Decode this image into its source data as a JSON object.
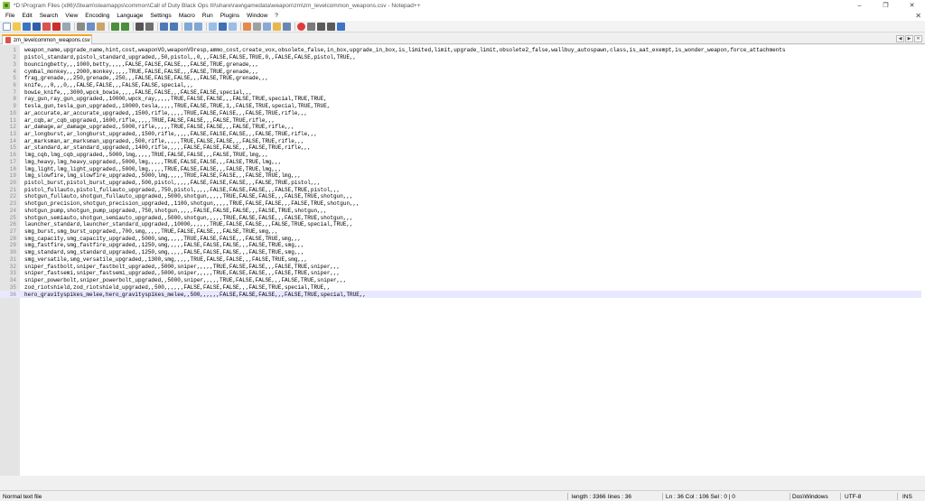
{
  "window": {
    "title": "*D:\\Program Files (x86)\\Steam\\steamapps\\common\\Call of Duty Black Ops III\\share\\raw\\gamedata\\weapon\\zm\\zm_levelcommon_weapons.csv - Notepad++",
    "minimize": "–",
    "maximize": "❐",
    "close": "✕"
  },
  "menu": {
    "items": [
      "File",
      "Edit",
      "Search",
      "View",
      "Encoding",
      "Language",
      "Settings",
      "Macro",
      "Run",
      "Plugins",
      "Window",
      "?"
    ],
    "close": "✕"
  },
  "toolbar": {
    "buttons": [
      "new-file-icon",
      "open-file-icon",
      "save-icon",
      "save-all-icon",
      "close-icon",
      "close-all-icon",
      "print-icon",
      "cut-icon",
      "copy-icon",
      "paste-icon",
      "undo-icon",
      "redo-icon",
      "find-icon",
      "replace-icon",
      "zoom-in-icon",
      "zoom-out-icon",
      "sync-v-icon",
      "sync-h-icon",
      "word-wrap-icon",
      "show-all-chars-icon",
      "indent-guide-icon",
      "udl-icon",
      "doc-map-icon",
      "function-list-icon",
      "folder-workspace-icon",
      "monitor-icon",
      "record-macro-icon",
      "stop-record-icon",
      "play-macro-icon",
      "play-multiple-icon",
      "save-macro-icon"
    ]
  },
  "tab": {
    "label": "zm_levelcommon_weapons.csv",
    "close": "✕"
  },
  "tab_nav": {
    "left": "◀",
    "right": "▶",
    "close": "✕"
  },
  "editor": {
    "current_line": 36,
    "lines": [
      "weapon_name,upgrade_name,hint,cost,weaponVO,weaponVOresp,ammo_cost,create_vox,obsolete_false,in_box,upgrade_in_box,is_limited,limit,upgrade_limit,obsolete2_false,wallbuy_autospawn,class,is_aat_exempt,is_wonder_weapon,force_attachments",
      "pistol_standard,pistol_standard_upgraded,,50,pistol,,0,,,FALSE,FALSE,TRUE,0,,FALSE,FALSE,pistol,TRUE,,",
      "bouncingbetty,,,1000,betty,,,,,FALSE,FALSE,FALSE,,,FALSE,TRUE,grenade,,,",
      "cymbal_monkey,,,2000,monkey,,,,,TRUE,FALSE,FALSE,,,FALSE,TRUE,grenade,,,",
      "frag_grenade,,,250,grenade,,250,,,FALSE,FALSE,FALSE,,,FALSE,TRUE,grenade,,,",
      "knife,,,0,,,0,,,FALSE,FALSE,,,FALSE,FALSE,special,,,",
      "bowie_knife,,,3000,wpck_bowie,,,,,FALSE,FALSE,,,FALSE,FALSE,special,,,",
      "ray_gun,ray_gun_upgraded,,10000,wpck_ray,,,,,TRUE,FALSE,FALSE,,,FALSE,TRUE,special,TRUE,TRUE,",
      "tesla_gun,tesla_gun_upgraded,,10000,tesla,,,,,TRUE,FALSE,TRUE,1,,FALSE,TRUE,special,TRUE,TRUE,",
      "ar_accurate,ar_accurate_upgraded,,1500,rifle,,,,,TRUE,FALSE,FALSE,,,FALSE,TRUE,rifle,,,",
      "ar_cqb,ar_cqb_upgraded,,1600,rifle,,,,,TRUE,FALSE,FALSE,,,FALSE,TRUE,rifle,,,",
      "ar_damage,ar_damage_upgraded,,5000,rifle,,,,,TRUE,FALSE,FALSE,,,FALSE,TRUE,rifle,,,",
      "ar_longburst,ar_longburst_upgraded,,1500,rifle,,,,,FALSE,FALSE,FALSE,,,FALSE,TRUE,rifle,,,",
      "ar_marksman,ar_marksman_upgraded,,500,rifle,,,,,TRUE,FALSE,FALSE,,,FALSE,TRUE,rifle,,,",
      "ar_standard,ar_standard_upgraded,,1400,rifle,,,,,FALSE,FALSE,FALSE,,,FALSE,TRUE,rifle,,,",
      "lmg_cqb,lmg_cqb_upgraded,,5000,lmg,,,,,TRUE,FALSE,FALSE,,,FALSE,TRUE,lmg,,,",
      "lmg_heavy,lmg_heavy_upgraded,,5000,lmg,,,,,TRUE,FALSE,FALSE,,,FALSE,TRUE,lmg,,,",
      "lmg_light,lmg_light_upgraded,,5000,lmg,,,,,TRUE,FALSE,FALSE,,,FALSE,TRUE,lmg,,,",
      "lmg_slowfire,lmg_slowfire_upgraded,,5000,lmg,,,,,TRUE,FALSE,FALSE,,,FALSE,TRUE,lmg,,,",
      "pistol_burst,pistol_burst_upgraded,,500,pistol,,,,,FALSE,FALSE,FALSE,,,FALSE,TRUE,pistol,,,",
      "pistol_fullauto,pistol_fullauto_upgraded,,750,pistol,,,,,FALSE,FALSE,FALSE,,,FALSE,TRUE,pistol,,,",
      "shotgun_fullauto,shotgun_fullauto_upgraded,,5000,shotgun,,,,,TRUE,FALSE,FALSE,,,FALSE,TRUE,shotgun,,,",
      "shotgun_precision,shotgun_precision_upgraded,,1100,shotgun,,,,,TRUE,FALSE,FALSE,,,FALSE,TRUE,shotgun,,,",
      "shotgun_pump,shotgun_pump_upgraded,,750,shotgun,,,,,FALSE,FALSE,FALSE,,,FALSE,TRUE,shotgun,,,",
      "shotgun_semiauto,shotgun_semiauto_upgraded,,5000,shotgun,,,,,TRUE,FALSE,FALSE,,,FALSE,TRUE,shotgun,,,",
      "launcher_standard,launcher_standard_upgraded,,10000,,,,,,TRUE,FALSE,FALSE,,,FALSE,TRUE,special,TRUE,,",
      "smg_burst,smg_burst_upgraded,,700,smg,,,,,TRUE,FALSE,FALSE,,,FALSE,TRUE,smg,,,",
      "smg_capacity,smg_capacity_upgraded,,5000,smg,,,,,TRUE,FALSE,FALSE,,,FALSE,TRUE,smg,,,",
      "smg_fastfire,smg_fastfire_upgraded,,1250,smg,,,,,FALSE,FALSE,FALSE,,,FALSE,TRUE,smg,,,",
      "smg_standard,smg_standard_upgraded,,1250,smg,,,,,FALSE,FALSE,FALSE,,,FALSE,TRUE,smg,,,",
      "smg_versatile,smg_versatile_upgraded,,1300,smg,,,,,TRUE,FALSE,FALSE,,,FALSE,TRUE,smg,,,",
      "sniper_fastbolt,sniper_fastbolt_upgraded,,5000,sniper,,,,,TRUE,FALSE,FALSE,,,FALSE,TRUE,sniper,,,",
      "sniper_fastsemi,sniper_fastsemi_upgraded,,5000,sniper,,,,,TRUE,FALSE,FALSE,,,FALSE,TRUE,sniper,,,",
      "sniper_powerbolt,sniper_powerbolt_upgraded,,5000,sniper,,,,,TRUE,FALSE,FALSE,,,FALSE,TRUE,sniper,,,",
      "zod_riotshield,zod_riotshield_upgraded,,500,,,,,,FALSE,FALSE,FALSE,,,FALSE,TRUE,special,TRUE,,",
      "hero_gravityspikes_melee,hero_gravityspikes_melee,,500,,,,,,FALSE,FALSE,FALSE,,,FALSE,TRUE,special,TRUE,,"
    ]
  },
  "scroll": {
    "left": "◀",
    "right": "▶"
  },
  "status": {
    "file_type": "Normal text file",
    "length": "length : 3366",
    "lines": "lines : 36",
    "position": "Ln : 36    Col : 106    Sel : 0 | 0",
    "eol": "Dos\\Windows",
    "encoding": "UTF-8",
    "mode": "INS"
  },
  "colors": {
    "tab_accent": "#f5a623",
    "current_line": "#e8e8ff",
    "gutter": "#e4e4e4"
  }
}
